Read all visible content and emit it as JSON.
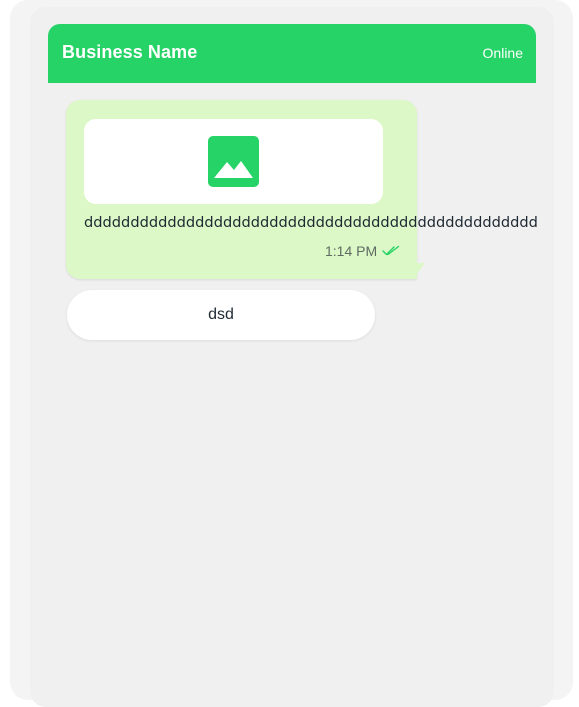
{
  "header": {
    "title": "Business Name",
    "status": "Online"
  },
  "message": {
    "media_icon": "image-icon",
    "text": "ddddddddddddddddddddddddddddddddddddddddddddddddd",
    "time": "1:14 PM",
    "status_icon": "double-check-icon"
  },
  "quick_reply": {
    "label": "dsd"
  },
  "colors": {
    "header": "#25d366",
    "bubble": "#dcf8c6",
    "background": "#f0f0f0",
    "icon": "#25d366"
  }
}
